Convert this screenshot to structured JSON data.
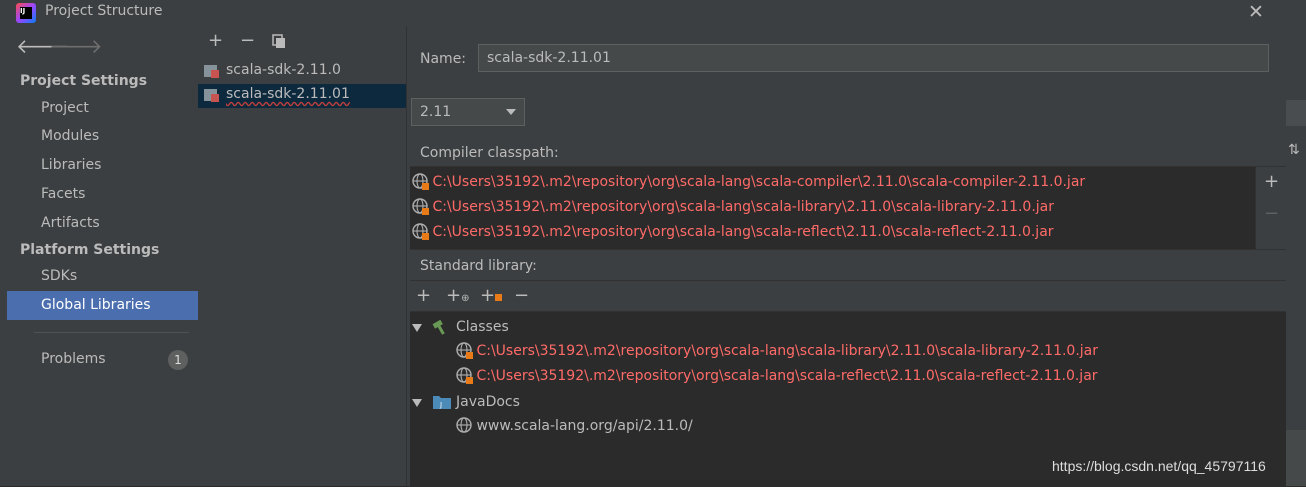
{
  "window": {
    "title": "Project Structure",
    "logo_text": "IJ",
    "close_icon": "close-icon"
  },
  "nav": {
    "project_settings_header": "Project Settings",
    "project_items": [
      "Project",
      "Modules",
      "Libraries",
      "Facets",
      "Artifacts"
    ],
    "platform_settings_header": "Platform Settings",
    "platform_items": [
      "SDKs",
      "Global Libraries"
    ],
    "selected": "Global Libraries",
    "problems_label": "Problems",
    "problems_count": "1"
  },
  "list": {
    "items": [
      "scala-sdk-2.11.0",
      "scala-sdk-2.11.01"
    ],
    "selected_index": 1
  },
  "detail": {
    "name_label": "Name:",
    "name_value": "scala-sdk-2.11.01",
    "version_value": "2.11",
    "compiler_classpath_label": "Compiler classpath:",
    "compiler_classpath": [
      "C:\\Users\\35192\\.m2\\repository\\org\\scala-lang\\scala-compiler\\2.11.0\\scala-compiler-2.11.0.jar",
      "C:\\Users\\35192\\.m2\\repository\\org\\scala-lang\\scala-library\\2.11.0\\scala-library-2.11.0.jar",
      "C:\\Users\\35192\\.m2\\repository\\org\\scala-lang\\scala-reflect\\2.11.0\\scala-reflect-2.11.0.jar"
    ],
    "standard_library_label": "Standard library:",
    "classes_label": "Classes",
    "classes": [
      "C:\\Users\\35192\\.m2\\repository\\org\\scala-lang\\scala-library\\2.11.0\\scala-library-2.11.0.jar",
      "C:\\Users\\35192\\.m2\\repository\\org\\scala-lang\\scala-reflect\\2.11.0\\scala-reflect-2.11.0.jar"
    ],
    "javadocs_label": "JavaDocs",
    "javadocs": [
      "www.scala-lang.org/api/2.11.0/"
    ]
  },
  "watermark": "https://blog.csdn.net/qq_45797116",
  "colors": {
    "background": "#3c3f41",
    "selection": "#4b6eaf",
    "list_selection": "#0d293e",
    "error_text": "#ff6b68",
    "text": "#bbbbbb"
  }
}
